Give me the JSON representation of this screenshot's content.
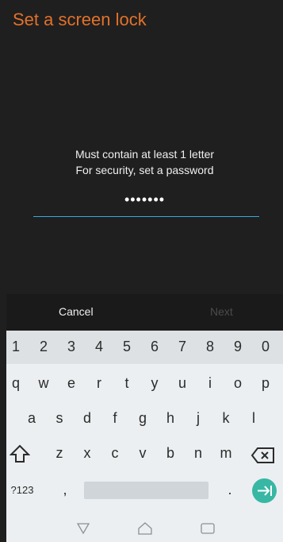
{
  "header": {
    "title": "Set a screen lock"
  },
  "messages": {
    "line1": "Must contain at least 1 letter",
    "line2": "For security, set a password"
  },
  "password": {
    "masked_value": "•••••••"
  },
  "actions": {
    "cancel_label": "Cancel",
    "next_label": "Next"
  },
  "keyboard": {
    "numbers": [
      "1",
      "2",
      "3",
      "4",
      "5",
      "6",
      "7",
      "8",
      "9",
      "0"
    ],
    "row1": [
      "q",
      "w",
      "e",
      "r",
      "t",
      "y",
      "u",
      "i",
      "o",
      "p"
    ],
    "row2": [
      "a",
      "s",
      "d",
      "f",
      "g",
      "h",
      "j",
      "k",
      "l"
    ],
    "row3": [
      "z",
      "x",
      "c",
      "v",
      "b",
      "n",
      "m"
    ],
    "symbols_label": "?123",
    "comma_label": ",",
    "period_label": ".",
    "icons": {
      "shift": "shift-icon",
      "backspace": "backspace-icon",
      "enter": "enter-icon",
      "nav_back": "nav-back-icon",
      "nav_home": "nav-home-icon",
      "nav_recents": "nav-recents-icon"
    }
  },
  "colors": {
    "title": "#e2712a",
    "accent_underline": "#38a8d8",
    "enter_key": "#38b7a4",
    "background": "#1f1f1f",
    "keyboard_bg": "#eceff1"
  }
}
